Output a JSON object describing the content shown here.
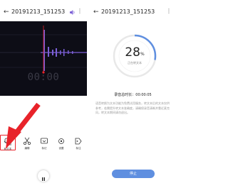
{
  "left": {
    "title": "20191213_151253",
    "back_icon": "back-arrow-icon",
    "more_icon": "more-icon",
    "timer": "00:00",
    "tools": [
      {
        "name": "tool-to-text",
        "label": "转文本",
        "icon": "speech-to-text-icon",
        "active": true
      },
      {
        "name": "tool-edit",
        "label": "编辑",
        "icon": "scissors-icon",
        "active": false
      },
      {
        "name": "tool-mark",
        "label": "标记",
        "icon": "flag-icon",
        "active": false
      },
      {
        "name": "tool-settings",
        "label": "设置",
        "icon": "gear-icon",
        "active": false
      },
      {
        "name": "tool-tag",
        "label": "标注",
        "icon": "tag-icon",
        "active": false
      }
    ],
    "pause_symbol": "II"
  },
  "right": {
    "title": "20191213_151253",
    "back_icon": "back-arrow-icon",
    "more_icon": "more-icon",
    "progress_percent": 28,
    "percent_sign": "%",
    "progress_sublabel": "正在转文本",
    "total_duration_label": "录音总时长：00:00:05",
    "description": "语音转换为文本功能为免费试用服务，转文本后的文本仅供参考，若需提升转文本准确度，请确保录音清晰并靠近麦克风，转文本期间请勿退出。",
    "stop_label": "停止"
  },
  "colors": {
    "accent_red": "#e8232a",
    "wave_bg": "#0d0d16",
    "wave_purple": "#7b5fd6",
    "playhead_red": "#e8232a",
    "ring_track": "#e8e8e8",
    "ring_fill": "#5f8fe0",
    "stop_button": "#5f8fe0",
    "volume_icon": "#7b5fd6"
  }
}
